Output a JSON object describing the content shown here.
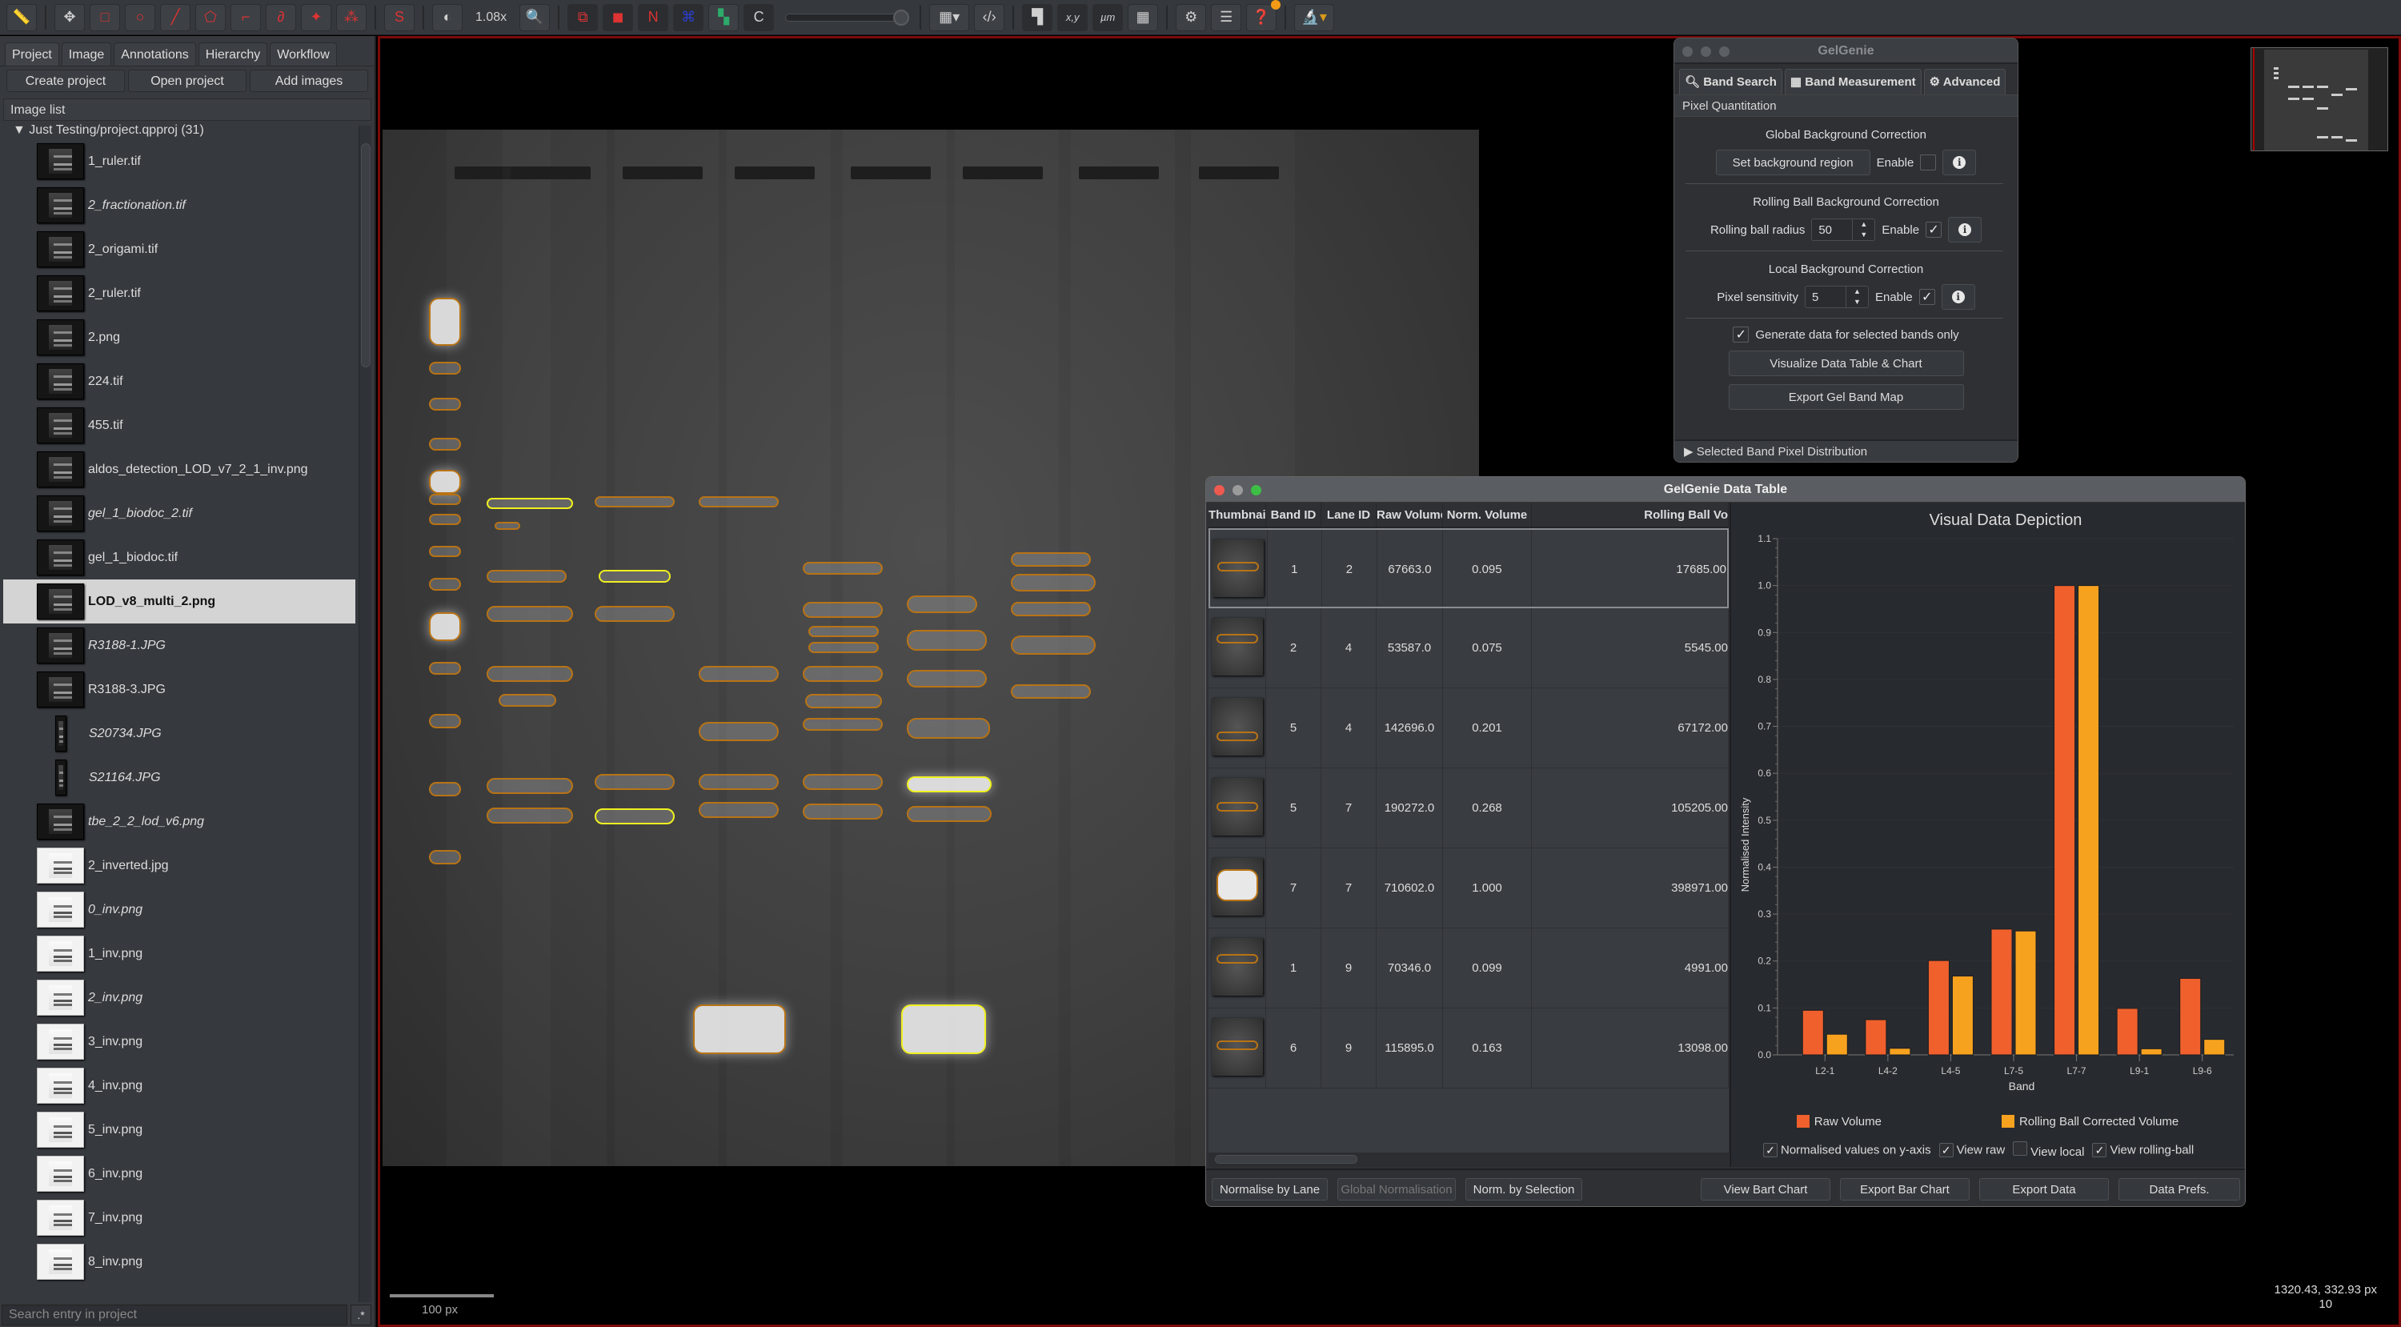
{
  "toolbar": {
    "zoom_level": "1.08x",
    "tools": [
      "measure-tool",
      "move-tool",
      "rectangle-tool",
      "ellipse-tool",
      "line-tool",
      "polygon-tool",
      "polyline-tool",
      "brush-tool",
      "wand-tool",
      "points-tool",
      "selection-mode",
      "brightness-contrast",
      "zoom-to-fit",
      "show-annotations",
      "fill-annotations",
      "show-names",
      "show-tma-grid",
      "show-detections",
      "fill-detections",
      "cell-boundaries",
      "opacity-slider",
      "grid-options",
      "scripting",
      "overview",
      "cursor-location",
      "scalebar",
      "pixel-grid",
      "preferences",
      "log",
      "help",
      "measurement-menu"
    ],
    "c_label": "C",
    "s_label": "S",
    "n_label": "N",
    "xy_label": "x,y",
    "um_label": "µm"
  },
  "left_panel": {
    "tabs": [
      "Project",
      "Image",
      "Annotations",
      "Hierarchy",
      "Workflow"
    ],
    "active_tab": "Project",
    "buttons": {
      "create": "Create project",
      "open": "Open project",
      "add": "Add images"
    },
    "image_list_header": "Image list",
    "project_root": "Just Testing/project.qpproj (31)",
    "images": [
      {
        "name": "1_ruler.tif",
        "italic": false,
        "light": false
      },
      {
        "name": "2_fractionation.tif",
        "italic": true,
        "light": false
      },
      {
        "name": "2_origami.tif",
        "italic": false,
        "light": false
      },
      {
        "name": "2_ruler.tif",
        "italic": false,
        "light": false
      },
      {
        "name": "2.png",
        "italic": false,
        "light": false
      },
      {
        "name": "224.tif",
        "italic": false,
        "light": false
      },
      {
        "name": "455.tif",
        "italic": false,
        "light": false
      },
      {
        "name": "aldos_detection_LOD_v7_2_1_inv.png",
        "italic": false,
        "light": false
      },
      {
        "name": "gel_1_biodoc_2.tif",
        "italic": true,
        "light": false
      },
      {
        "name": "gel_1_biodoc.tif",
        "italic": false,
        "light": false
      },
      {
        "name": "LOD_v8_multi_2.png",
        "italic": false,
        "light": false,
        "selected": true
      },
      {
        "name": "R3188-1.JPG",
        "italic": true,
        "light": false
      },
      {
        "name": "R3188-3.JPG",
        "italic": false,
        "light": false
      },
      {
        "name": "S20734.JPG",
        "italic": true,
        "light": false,
        "narrow": true
      },
      {
        "name": "S21164.JPG",
        "italic": true,
        "light": false,
        "narrow": true
      },
      {
        "name": "tbe_2_2_lod_v6.png",
        "italic": true,
        "light": false
      },
      {
        "name": "2_inverted.jpg",
        "italic": false,
        "light": true
      },
      {
        "name": "0_inv.png",
        "italic": true,
        "light": true
      },
      {
        "name": "1_inv.png",
        "italic": false,
        "light": true
      },
      {
        "name": "2_inv.png",
        "italic": true,
        "light": true
      },
      {
        "name": "3_inv.png",
        "italic": false,
        "light": true
      },
      {
        "name": "4_inv.png",
        "italic": false,
        "light": true
      },
      {
        "name": "5_inv.png",
        "italic": false,
        "light": true
      },
      {
        "name": "6_inv.png",
        "italic": false,
        "light": true
      },
      {
        "name": "7_inv.png",
        "italic": false,
        "light": true
      },
      {
        "name": "8_inv.png",
        "italic": false,
        "light": true
      }
    ],
    "search_placeholder": "Search entry in project",
    "regex_label": ".*"
  },
  "viewer": {
    "scalebar_label": "100 px",
    "cursor_coords": "1320.43, 332.93 px",
    "cursor_value": "10"
  },
  "gelgenie": {
    "title": "GelGenie",
    "tabs": [
      "Band Search",
      "Band Measurement",
      "Advanced"
    ],
    "section_header": "Pixel Quantitation",
    "global": {
      "title": "Global Background Correction",
      "button": "Set background region",
      "enable_label": "Enable",
      "enabled": false
    },
    "rolling": {
      "title": "Rolling Ball Background Correction",
      "label": "Rolling ball radius",
      "value": "50",
      "enable_label": "Enable",
      "enabled": true
    },
    "local": {
      "title": "Local Background Correction",
      "label": "Pixel sensitivity",
      "value": "5",
      "enable_label": "Enable",
      "enabled": true
    },
    "selected_only": {
      "label": "Generate data for selected bands only",
      "checked": true
    },
    "visualize_button": "Visualize Data Table & Chart",
    "export_map_button": "Export Gel Band Map",
    "collapsed_section": "Selected Band Pixel Distribution"
  },
  "data_table": {
    "title": "GelGenie Data Table",
    "columns": [
      "Thumbnail",
      "Band ID",
      "Lane ID",
      "Raw Volume",
      "Norm. Volume",
      "Rolling Ball Vo"
    ],
    "rows": [
      {
        "band_id": "1",
        "lane_id": "2",
        "raw": "67663.0",
        "norm": "0.095",
        "rolling": "17685.00"
      },
      {
        "band_id": "2",
        "lane_id": "4",
        "raw": "53587.0",
        "norm": "0.075",
        "rolling": "5545.00"
      },
      {
        "band_id": "5",
        "lane_id": "4",
        "raw": "142696.0",
        "norm": "0.201",
        "rolling": "67172.00"
      },
      {
        "band_id": "5",
        "lane_id": "7",
        "raw": "190272.0",
        "norm": "0.268",
        "rolling": "105205.00"
      },
      {
        "band_id": "7",
        "lane_id": "7",
        "raw": "710602.0",
        "norm": "1.000",
        "rolling": "398971.00"
      },
      {
        "band_id": "1",
        "lane_id": "9",
        "raw": "70346.0",
        "norm": "0.099",
        "rolling": "4991.00"
      },
      {
        "band_id": "6",
        "lane_id": "9",
        "raw": "115895.0",
        "norm": "0.163",
        "rolling": "13098.00"
      }
    ],
    "bottom_buttons": {
      "normalise_lane": "Normalise by Lane",
      "global_norm": "Global Normalisation",
      "norm_selection": "Norm. by Selection",
      "view_chart": "View Bart Chart",
      "export_chart": "Export Bar Chart",
      "export_data": "Export Data",
      "data_prefs": "Data Prefs."
    },
    "chart_options": [
      {
        "label": "Normalised values on y-axis",
        "checked": true
      },
      {
        "label": "View raw",
        "checked": true
      },
      {
        "label": "View local",
        "checked": false
      },
      {
        "label": "View rolling-ball",
        "checked": true
      }
    ]
  },
  "chart_data": {
    "type": "bar",
    "title": "Visual Data Depiction",
    "xlabel": "Band",
    "ylabel": "Normalised Intensity",
    "ylim": [
      0,
      1.1
    ],
    "yticks": [
      "0.0",
      "0.1",
      "0.2",
      "0.3",
      "0.4",
      "0.5",
      "0.6",
      "0.7",
      "0.8",
      "0.9",
      "1.0",
      "1.1"
    ],
    "categories": [
      "L2-1",
      "L4-2",
      "L4-5",
      "L7-5",
      "L7-7",
      "L9-1",
      "L9-6"
    ],
    "series": [
      {
        "name": "Raw Volume",
        "color": "#f0602d",
        "values": [
          0.095,
          0.075,
          0.201,
          0.268,
          1.0,
          0.099,
          0.163
        ]
      },
      {
        "name": "Rolling Ball Corrected Volume",
        "color": "#f7a21f",
        "values": [
          0.044,
          0.014,
          0.168,
          0.264,
          1.0,
          0.013,
          0.033
        ]
      }
    ],
    "grid": true,
    "legend": "bottom"
  }
}
